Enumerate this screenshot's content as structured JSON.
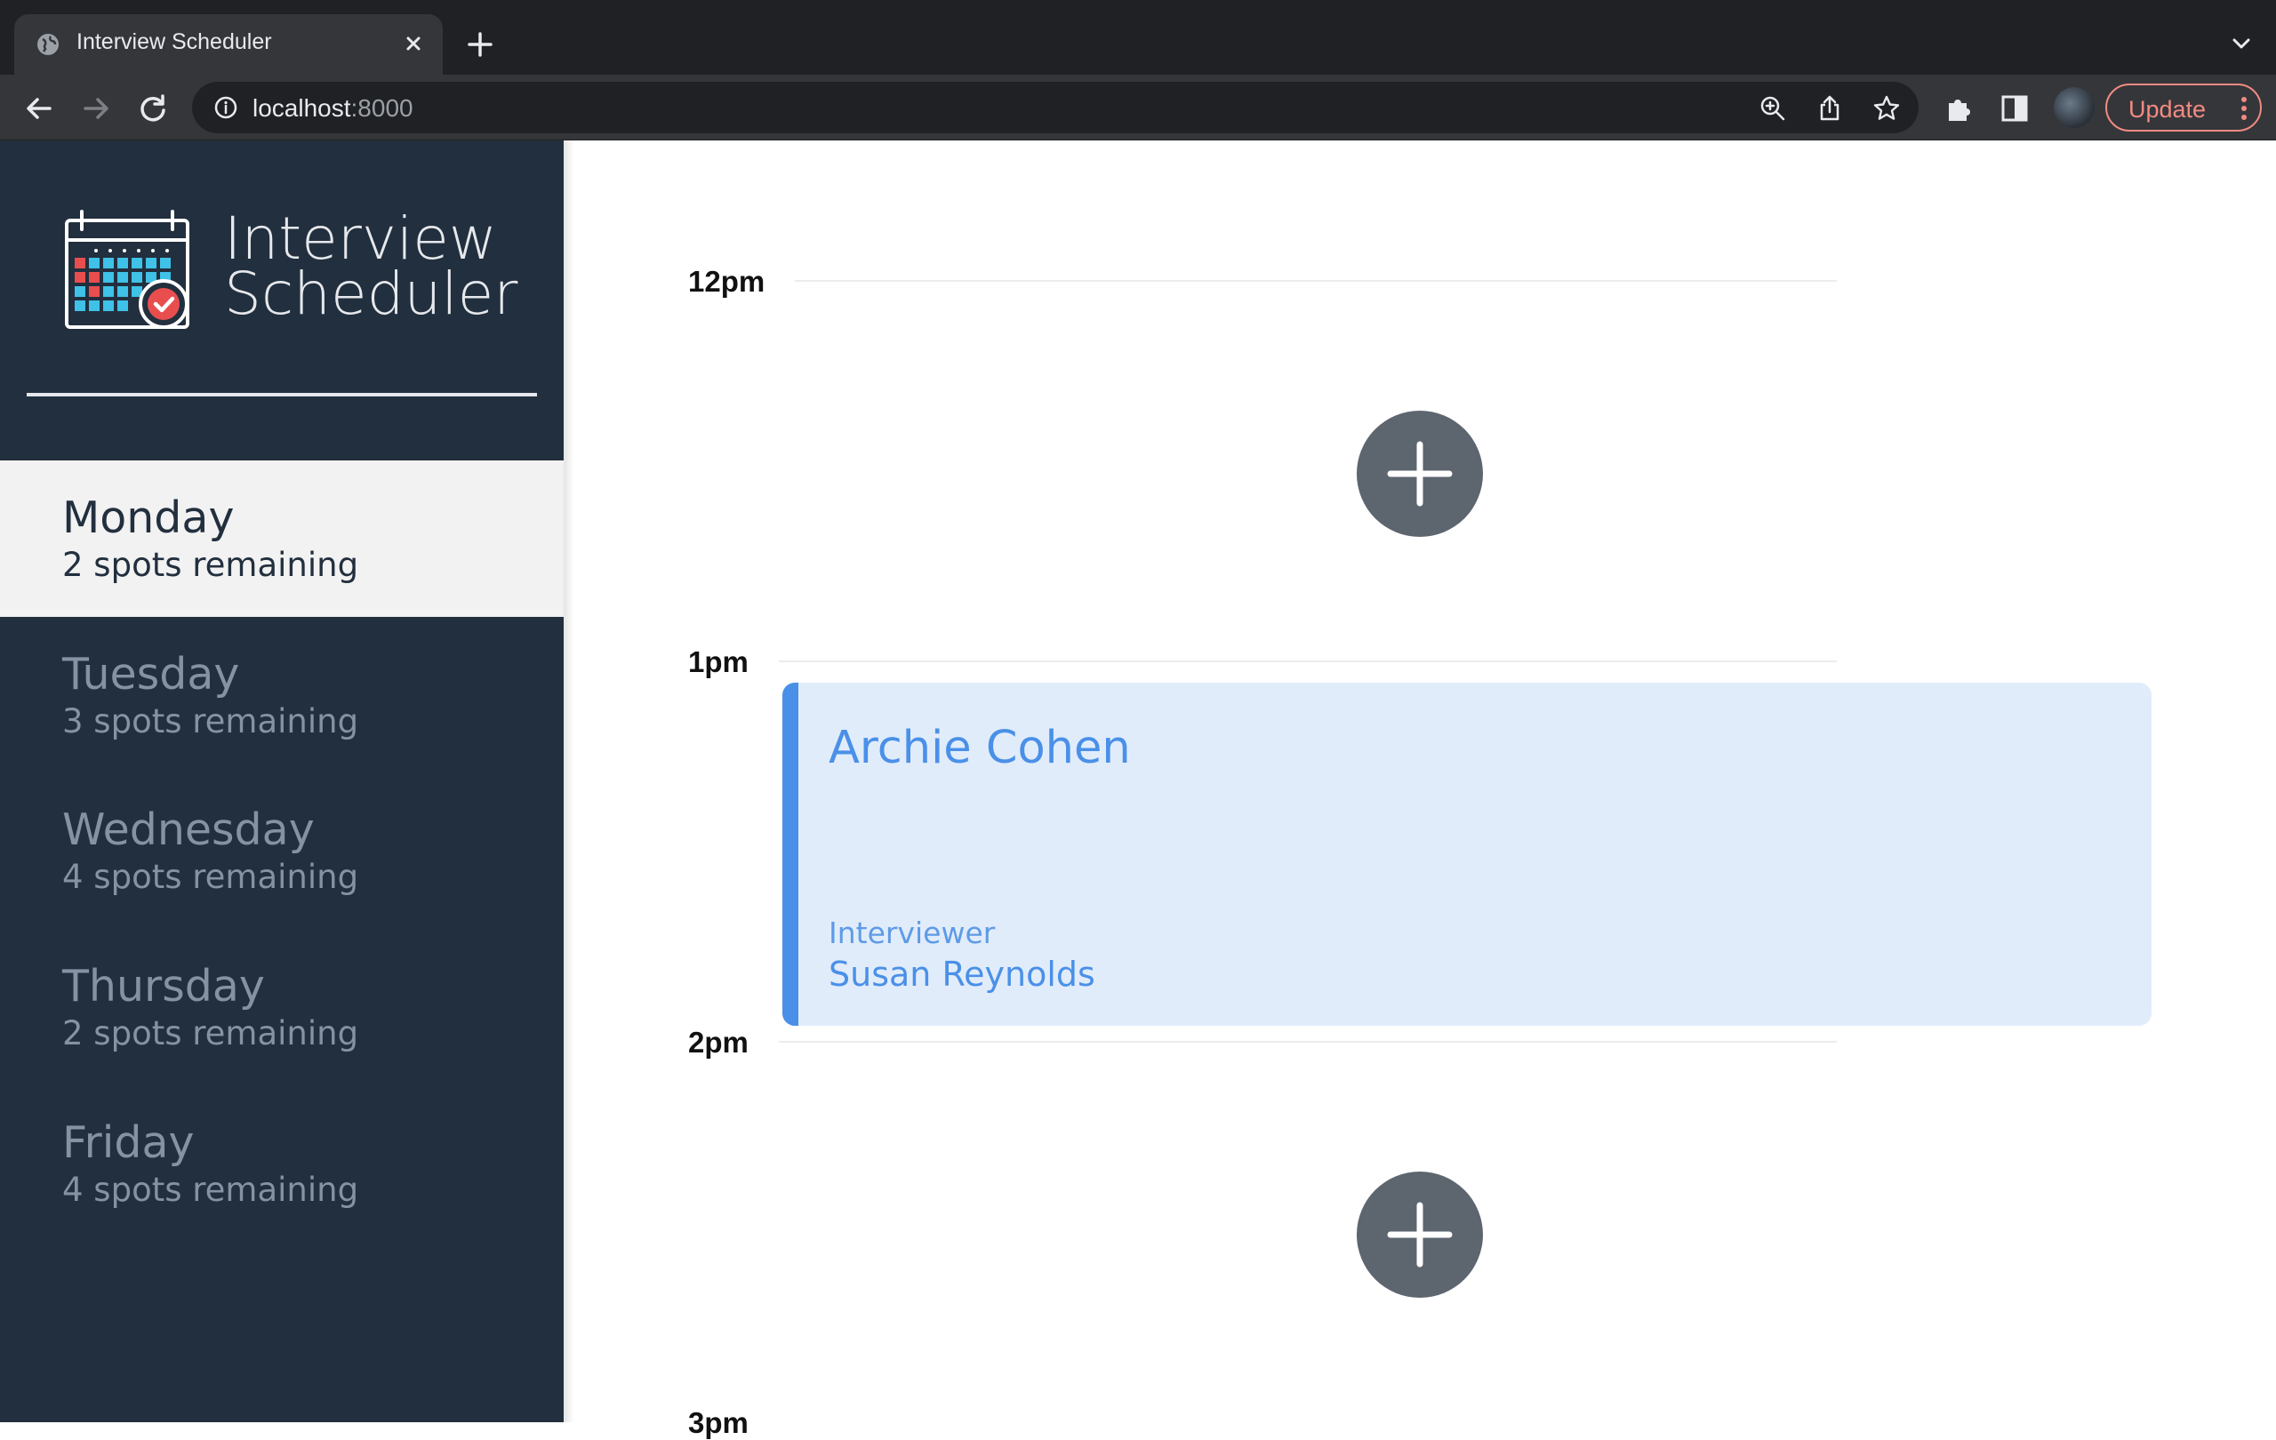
{
  "browser": {
    "tab_title": "Interview Scheduler",
    "url_host": "localhost",
    "url_port": ":8000",
    "update_label": "Update"
  },
  "app": {
    "brand_line1": "Interview",
    "brand_line2": "Scheduler"
  },
  "days": [
    {
      "name": "Monday",
      "spots": "2 spots remaining",
      "selected": true
    },
    {
      "name": "Tuesday",
      "spots": "3 spots remaining",
      "selected": false
    },
    {
      "name": "Wednesday",
      "spots": "4 spots remaining",
      "selected": false
    },
    {
      "name": "Thursday",
      "spots": "2 spots remaining",
      "selected": false
    },
    {
      "name": "Friday",
      "spots": "4 spots remaining",
      "selected": false
    }
  ],
  "schedule": {
    "times": [
      "12pm",
      "1pm",
      "2pm",
      "3pm"
    ],
    "appointment": {
      "student": "Archie Cohen",
      "interviewer_label": "Interviewer",
      "interviewer": "Susan Reynolds"
    }
  },
  "colors": {
    "sidebar": "#222f3e",
    "accent": "#4a90e8",
    "appointment_bg": "#e1ecfb",
    "add_button": "#5d656f"
  }
}
